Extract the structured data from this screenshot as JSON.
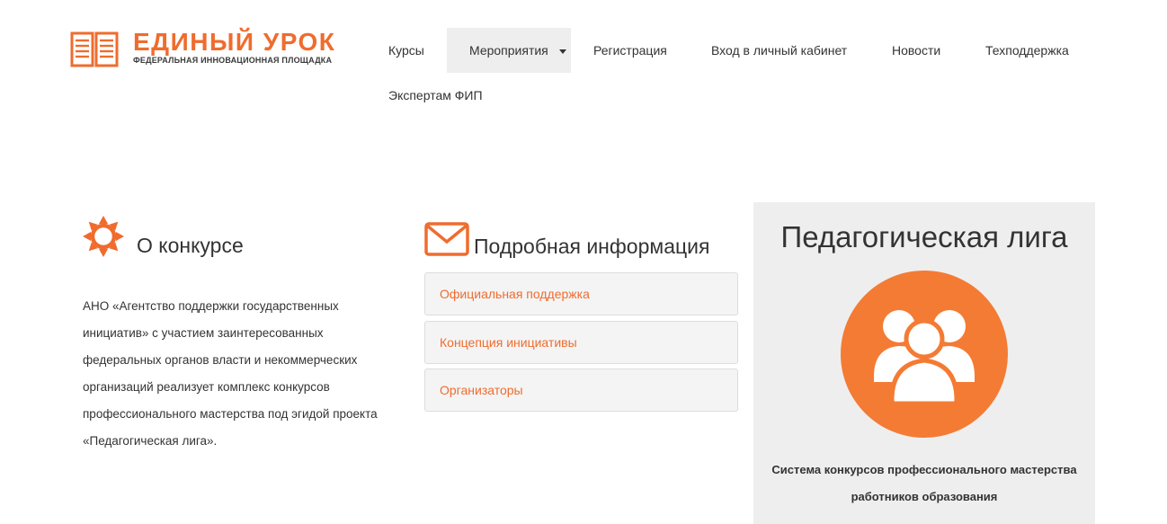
{
  "header": {
    "logo_title": "ЕДИНЫЙ УРОК",
    "logo_subtitle": "ФЕДЕРАЛЬНАЯ ИННОВАЦИОННАЯ ПЛОЩАДКА",
    "nav": [
      {
        "label": "Курсы"
      },
      {
        "label": "Мероприятия",
        "active": true
      },
      {
        "label": "Регистрация"
      },
      {
        "label": "Вход в личный кабинет"
      },
      {
        "label": "Новости"
      },
      {
        "label": "Техподдержка"
      },
      {
        "label": "Экспертам ФИП"
      }
    ]
  },
  "about": {
    "icon": "sun-icon",
    "title": "О конкурсе",
    "text": "АНО «Агентство поддержки государственных инициатив» с участием заинтересованных федеральных органов власти и некоммерческих организаций реализует комплекс конкурсов профессионального мастерства под эгидой проекта «Педагогическая лига»."
  },
  "info": {
    "icon": "envelope-icon",
    "title": "Подробная информация",
    "items": [
      {
        "label": "Официальная поддержка"
      },
      {
        "label": "Концепция инициативы"
      },
      {
        "label": "Организаторы"
      }
    ]
  },
  "league": {
    "title": "Педагогическая лига",
    "icon": "users-group-icon",
    "caption": "Система конкурсов профессионального мастерства работников образования"
  },
  "colors": {
    "accent": "#ef6c2e",
    "circle": "#f47b34",
    "panel": "#eeeeee",
    "text": "#333333"
  }
}
